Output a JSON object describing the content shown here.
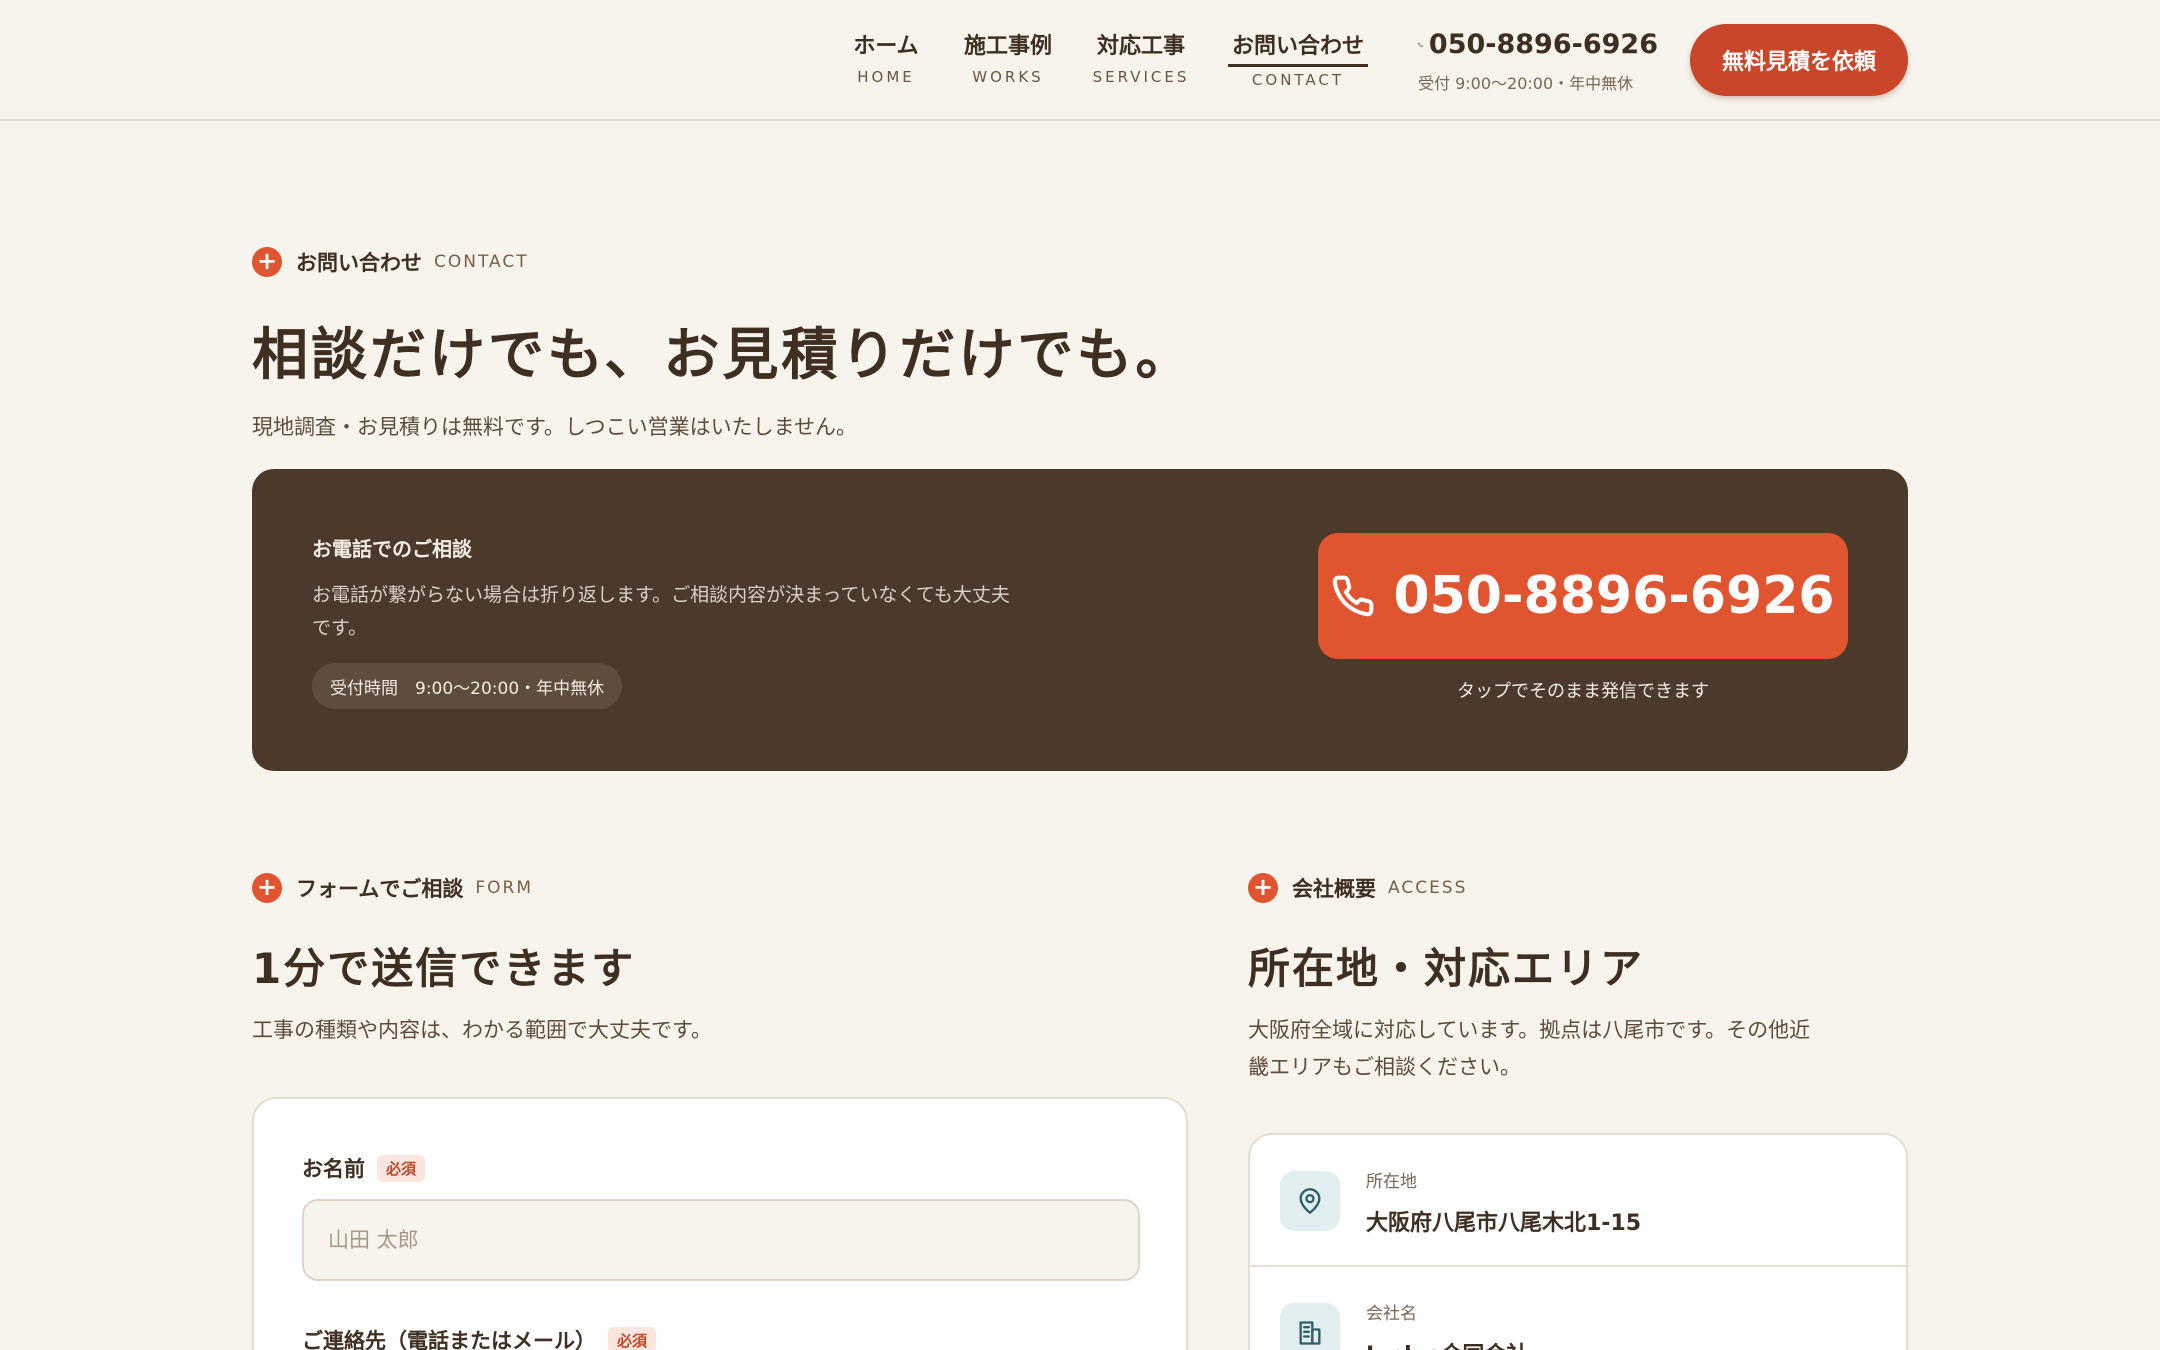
{
  "nav": {
    "items": [
      {
        "jp": "ホーム",
        "en": "HOME"
      },
      {
        "jp": "施工事例",
        "en": "WORKS"
      },
      {
        "jp": "対応工事",
        "en": "SERVICES"
      },
      {
        "jp": "お問い合わせ",
        "en": "CONTACT"
      }
    ],
    "active": "CONTACT",
    "phone": "050-8896-6926",
    "hours": "受付 9:00〜20:00・年中無休",
    "cta": "無料見積を依頼"
  },
  "contact": {
    "eyebrow_jp": "お問い合わせ",
    "eyebrow_en": "CONTACT",
    "title": "相談だけでも、お見積りだけでも。",
    "lead": "現地調査・お見積りは無料です。しつこい営業はいたしません。"
  },
  "phone_panel": {
    "title": "お電話でのご相談",
    "desc": "お電話が繋がらない場合は折り返します。ご相談内容が決まっていなくても大丈夫です。",
    "hours": "受付時間　9:00〜20:00・年中無休",
    "number": "050-8896-6926",
    "note": "タップでそのまま発信できます"
  },
  "form": {
    "eyebrow_jp": "フォームでご相談",
    "eyebrow_en": "FORM",
    "title": "1分で送信できます",
    "lead": "工事の種類や内容は、わかる範囲で大丈夫です。",
    "name_label": "お名前",
    "required": "必須",
    "name_placeholder": "山田 太郎",
    "contact_label": "ご連絡先（電話またはメール）"
  },
  "access": {
    "eyebrow_jp": "会社概要",
    "eyebrow_en": "ACCESS",
    "title": "所在地・対応エリア",
    "lead": "大阪府全域に対応しています。拠点は八尾市です。その他近畿エリアもご相談ください。",
    "rows": [
      {
        "key": "所在地",
        "value": "大阪府八尾市八尾木北1-15",
        "icon": "map-pin-icon"
      },
      {
        "key": "会社名",
        "value": "L.plus合同会社",
        "icon": "building-icon"
      }
    ]
  },
  "colors": {
    "accent": "#e0552f",
    "cta": "#c9462b",
    "panel": "#4b3a2b",
    "background": "#f7f4ee"
  }
}
